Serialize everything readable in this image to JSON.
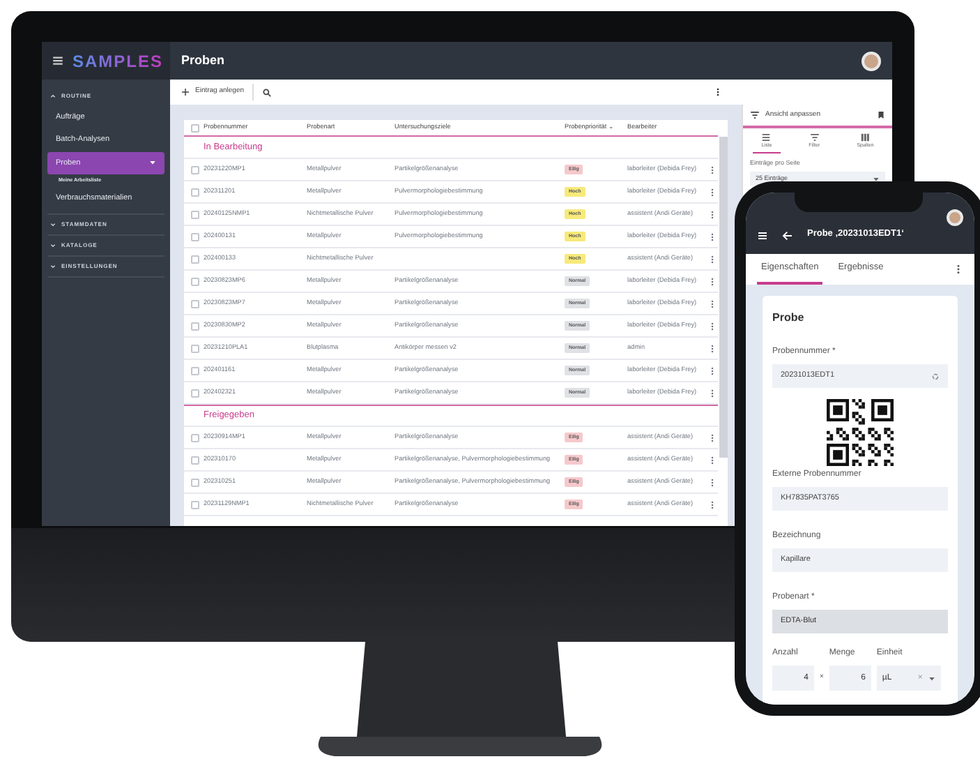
{
  "desktop": {
    "logo": "SAMPLES",
    "page_title": "Proben",
    "sidebar": [
      {
        "label": "ROUTINE",
        "expanded": true,
        "items": [
          {
            "label": "Aufträge",
            "selected": false
          },
          {
            "label": "Batch-Analysen",
            "selected": false
          },
          {
            "label": "Proben",
            "selected": true,
            "expanded": true,
            "children": [
              {
                "label": "Meine Arbeitsliste",
                "selected": false
              }
            ]
          },
          {
            "label": "Verbrauchsmaterialien",
            "selected": false
          }
        ]
      },
      {
        "label": "STAMMDATEN",
        "expanded": false
      },
      {
        "label": "KATALOGE",
        "expanded": false
      },
      {
        "label": "EINSTELLUNGEN",
        "expanded": false
      }
    ],
    "toolbar": {
      "add_button": "Eintrag anlegen"
    },
    "table": {
      "columns": [
        "Probennummer",
        "Probenart",
        "Untersuchungsziele",
        "Probenpriorität",
        "Bearbeiter"
      ],
      "sort_indicator": "⌄",
      "select_all_checked": false,
      "groups": [
        {
          "title": "In Bearbeitung",
          "rows": [
            {
              "cells": [
                "20231220MP1",
                "Metallpulver",
                "Partikelgrößenanalyse",
                "Eilig",
                "laborleiter (Debida Frey)"
              ],
              "color": "#f6c9cc",
              "checked": false
            },
            {
              "cells": [
                "202311201",
                "Metallpulver",
                "Pulvermorphologiebestimmung",
                "Hoch",
                "laborleiter (Debida Frey)"
              ],
              "color": "#f7ea7a",
              "checked": false
            },
            {
              "cells": [
                "20240125NMP1",
                "Nichtmetallische Pulver",
                "Pulvermorphologiebestimmung",
                "Hoch",
                "assistent (Andi Geräte)"
              ],
              "color": "#f7ea7a",
              "checked": false
            },
            {
              "cells": [
                "202400131",
                "Metallpulver",
                "Pulvermorphologiebestimmung",
                "Hoch",
                "laborleiter (Debida Frey)"
              ],
              "color": "#f7ea7a",
              "checked": false
            },
            {
              "cells": [
                "202400133",
                "Nichtmetallische Pulver",
                "",
                "Hoch",
                "assistent (Andi Geräte)"
              ],
              "color": "#f7ea7a",
              "checked": false
            },
            {
              "cells": [
                "20230823MP6",
                "Metallpulver",
                "Partikelgrößenanalyse",
                "Normal",
                "laborleiter (Debida Frey)"
              ],
              "color": "#dfe1e5",
              "checked": false
            },
            {
              "cells": [
                "20230823MP7",
                "Metallpulver",
                "Partikelgrößenanalyse",
                "Normal",
                "laborleiter (Debida Frey)"
              ],
              "color": "#dfe1e5",
              "checked": false
            },
            {
              "cells": [
                "20230830MP2",
                "Metallpulver",
                "Partikelgrößenanalyse",
                "Normal",
                "laborleiter (Debida Frey)"
              ],
              "color": "#dfe1e5",
              "checked": false
            },
            {
              "cells": [
                "20231210PLA1",
                "Blutplasma",
                "Antikörper messen v2",
                "Normal",
                "admin"
              ],
              "color": "#dfe1e5",
              "checked": false
            },
            {
              "cells": [
                "202401161",
                "Metallpulver",
                "Partikelgrößenanalyse",
                "Normal",
                "laborleiter (Debida Frey)"
              ],
              "color": "#dfe1e5",
              "checked": false
            },
            {
              "cells": [
                "202402321",
                "Metallpulver",
                "Partikelgrößenanalyse",
                "Normal",
                "laborleiter (Debida Frey)"
              ],
              "color": "#dfe1e5",
              "checked": false
            }
          ]
        },
        {
          "title": "Freigegeben",
          "rows": [
            {
              "cells": [
                "20230914MP1",
                "Metallpulver",
                "Partikelgrößenanalyse",
                "Eilig",
                "assistent (Andi Geräte)"
              ],
              "color": "#f6c9cc",
              "checked": false
            },
            {
              "cells": [
                "202310170",
                "Metallpulver",
                "Partikelgrößenanalyse, Pulvermorphologiebestimmung",
                "Eilig",
                "assistent (Andi Geräte)"
              ],
              "color": "#f6c9cc",
              "checked": false
            },
            {
              "cells": [
                "202310251",
                "Metallpulver",
                "Partikelgrößenanalyse, Pulvermorphologiebestimmung",
                "Eilig",
                "assistent (Andi Geräte)"
              ],
              "color": "#f6c9cc",
              "checked": false
            },
            {
              "cells": [
                "20231129NMP1",
                "Nichtmetallische Pulver",
                "Partikelgrößenanalyse",
                "Eilig",
                "assistent (Andi Geräte)"
              ],
              "color": "#f6c9cc",
              "checked": false
            }
          ]
        }
      ]
    },
    "view_panel": {
      "title": "Ansicht anpassen",
      "tabs": [
        {
          "label": "Liste",
          "selected": true
        },
        {
          "label": "Filter",
          "selected": false
        },
        {
          "label": "Spalten",
          "selected": false
        }
      ],
      "page_size_label": "Einträge pro Seite",
      "page_size": "25 Einträge"
    }
  },
  "phone": {
    "title": "Probe ‚20231013EDT1‘",
    "tabs": [
      {
        "label": "Eigenschaften",
        "selected": true
      },
      {
        "label": "Ergebnisse",
        "selected": false
      }
    ],
    "card_title": "Probe",
    "fields": [
      {
        "kind": "scan",
        "label": "Probennummer *",
        "value": "20231013EDT1"
      },
      {
        "kind": "qr"
      },
      {
        "kind": "text",
        "label": "Externe Probennummer",
        "value": "KH7835PAT3765"
      },
      {
        "kind": "text",
        "label": "Bezeichnung",
        "value": "Kapillare"
      },
      {
        "kind": "readonly",
        "label": "Probenart *",
        "value": "EDTA-Blut"
      }
    ],
    "amount": {
      "count_label": "Anzahl",
      "count": "4",
      "times": "×",
      "quantity_label": "Menge",
      "quantity": "6",
      "unit_label": "Einheit",
      "unit": "µL",
      "clear": "×"
    }
  }
}
